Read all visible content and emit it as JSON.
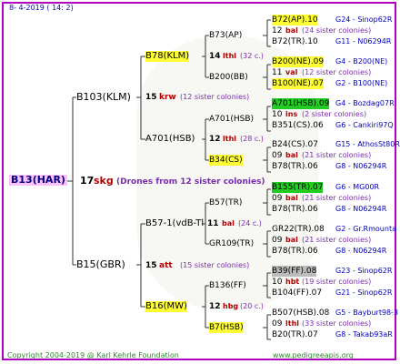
{
  "header": {
    "date": "8-   4-2019 (  14:   2)"
  },
  "root": {
    "name": "B13(HAR)",
    "num": "17",
    "dr": "skg",
    "sis": "(Drones from 12 sister colonies)"
  },
  "g1": [
    {
      "name": "B103(KLM)",
      "num": "15",
      "dr": "krw",
      "sis": "(12 sister colonies)"
    },
    {
      "name": "B15(GBR)",
      "num": "15",
      "dr": "att",
      "sis": "(15 sister colonies)"
    }
  ],
  "g2": [
    {
      "name": "B78(KLM)",
      "num": "14",
      "dr": "lthl",
      "sis": "(32 c.)"
    },
    {
      "name": "A701(HSB)",
      "num": "12",
      "dr": "lthl",
      "sis": "(28 c.)"
    },
    {
      "name": "B57-1(vdB-Tl",
      "num": "11",
      "dr": "bal",
      "sis": "(24 c.)"
    },
    {
      "name": "B16(MW)",
      "num": "12",
      "dr": "hbg",
      "sis": "(20 c.)"
    }
  ],
  "g3": [
    {
      "name": "B73(AP)"
    },
    {
      "name": "B200(BB)"
    },
    {
      "name": "A701(HSB)"
    },
    {
      "name": "B34(CS)"
    },
    {
      "name": "B57(TR)"
    },
    {
      "name": "GR109(TR)"
    },
    {
      "name": "B136(FF)"
    },
    {
      "name": "B7(HSB)"
    }
  ],
  "g4": [
    {
      "q": "B72(AP).10",
      "qp": "G24 - Sinop62R",
      "n": "12",
      "d": "bal",
      "s": "(24 sister colonies)",
      "f": "B72(TR).10",
      "fp": "G11 - N06294R"
    },
    {
      "q": "B200(NE).09",
      "qp": "G4 - B200(NE)",
      "n": "11",
      "d": "val",
      "s": "(12 sister colonies)",
      "f": "B100(NE).07",
      "fp": "G2 - B100(NE)"
    },
    {
      "q": "A701(HSB).09",
      "qp": "G4 - Bozdag07R",
      "n": "10",
      "d": "ins",
      "s": "(2 sister colonies)",
      "f": "B351(CS).06",
      "fp": "G6 - Cankiri97Q"
    },
    {
      "q": "B24(CS).07",
      "qp": "G15 - AthosSt80R",
      "n": "09",
      "d": "bal",
      "s": "(21 sister colonies)",
      "f": "B78(TR).06",
      "fp": "G8 - N06294R"
    },
    {
      "q": "B155(TR).07",
      "qp": "G6 - MG00R",
      "n": "09",
      "d": "bal",
      "s": "(21 sister colonies)",
      "f": "B78(TR).06",
      "fp": "G8 - N06294R"
    },
    {
      "q": "GR22(TR).08",
      "qp": "G2 - Gr.Rmounta",
      "n": "09",
      "d": "bal",
      "s": "(21 sister colonies)",
      "f": "B78(TR).06",
      "fp": "G8 - N06294R"
    },
    {
      "q": "B39(FF).08",
      "qp": "G23 - Sinop62R",
      "n": "10",
      "d": "hbt",
      "s": "(19 sister colonies)",
      "f": "B104(FF).07",
      "fp": "G21 - Sinop62R"
    },
    {
      "q": "B507(HSB).08",
      "qp": "G5 - Bayburt98-3",
      "n": "09",
      "d": "lthl",
      "s": "(33 sister colonies)",
      "f": "B20(TR).07",
      "fp": "G8 - Takab93aR"
    }
  ],
  "footer": {
    "copyright": "Copyright 2004-2019 @ Karl Kehrle Foundation",
    "url": "www.pedigreeapis.org"
  }
}
